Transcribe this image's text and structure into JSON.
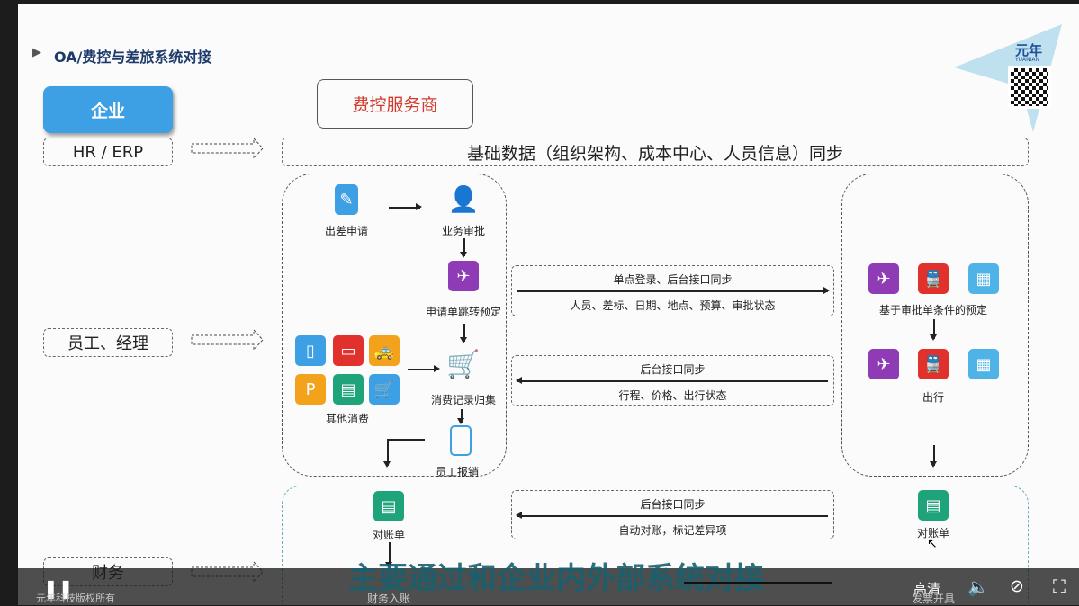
{
  "slide": {
    "title": "OA/费控与差旅系统对接",
    "logo": {
      "brand": "元年",
      "sub": "YUANIAN"
    },
    "enterprise_label": "企业",
    "provider_label": "费控服务商",
    "rows": {
      "hr_erp": "HR / ERP",
      "staff": "员工、经理",
      "finance": "财务"
    },
    "base_data": "基础数据（组织架构、成本中心、人员信息）同步",
    "left_flow": {
      "travel_request": "出差申请",
      "approval": "业务审批",
      "redirect_booking": "申请单跳转预定",
      "other_consumption": "其他消费",
      "consumption_collect": "消费记录归集",
      "reimbursement": "员工报销"
    },
    "sync1": {
      "title": "单点登录、后台接口同步",
      "detail": "人员、差标、日期、地点、预算、审批状态"
    },
    "sync2": {
      "title": "后台接口同步",
      "detail": "行程、价格、出行状态"
    },
    "sync3": {
      "title": "后台接口同步",
      "detail": "自动对账，标记差异项"
    },
    "right_flow": {
      "booking": "基于审批单条件的预定",
      "travel": "出行"
    },
    "bottom": {
      "statement_left": "对账单",
      "finance_entry": "财务入账",
      "statement_right": "对账单",
      "invoice": "发票开具"
    },
    "copyright": "元年科技版权所有"
  },
  "subtitle": "主要通过和企业内外部系统对接",
  "player": {
    "quality": "高清"
  },
  "colors": {
    "enterprise": "#3ea0e4",
    "plane": "#8e3bb5",
    "train": "#e0312d",
    "hotel": "#4fb3e8",
    "doc": "#1fa37a",
    "subtitle": "#17606f"
  }
}
